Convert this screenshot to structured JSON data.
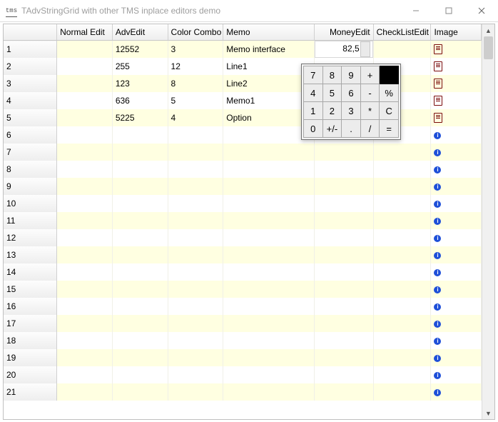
{
  "window": {
    "app_icon_text": "tms",
    "title": "TAdvStringGrid with other TMS inplace editors demo"
  },
  "columns": {
    "c0": "",
    "c1": "Normal Edit",
    "c2": "AdvEdit",
    "c3": "Color Combo",
    "c4": "Memo",
    "c5": "MoneyEdit",
    "c6": "CheckListEdit",
    "c7": "Image"
  },
  "money_editing_value": "82,5",
  "rows": [
    {
      "n": "1",
      "adv": "12552",
      "cc": "3",
      "memo": "Memo interface",
      "money": "82,5",
      "icon": "doc",
      "money_edit": true
    },
    {
      "n": "2",
      "adv": "255",
      "cc": "12",
      "memo": "Line1",
      "money": "",
      "icon": "doc"
    },
    {
      "n": "3",
      "adv": "123",
      "cc": "8",
      "memo": "Line2",
      "money": "",
      "icon": "doc"
    },
    {
      "n": "4",
      "adv": "636",
      "cc": "5",
      "memo": "Memo1",
      "money": "",
      "icon": "doc"
    },
    {
      "n": "5",
      "adv": "5225",
      "cc": "4",
      "memo": "Option",
      "money": "",
      "icon": "doc"
    },
    {
      "n": "6",
      "adv": "",
      "cc": "",
      "memo": "",
      "money": "",
      "icon": "info"
    },
    {
      "n": "7",
      "adv": "",
      "cc": "",
      "memo": "",
      "money": "",
      "icon": "info"
    },
    {
      "n": "8",
      "adv": "",
      "cc": "",
      "memo": "",
      "money": "",
      "icon": "info"
    },
    {
      "n": "9",
      "adv": "",
      "cc": "",
      "memo": "",
      "money": "",
      "icon": "info"
    },
    {
      "n": "10",
      "adv": "",
      "cc": "",
      "memo": "",
      "money": "",
      "icon": "info"
    },
    {
      "n": "11",
      "adv": "",
      "cc": "",
      "memo": "",
      "money": "",
      "icon": "info"
    },
    {
      "n": "12",
      "adv": "",
      "cc": "",
      "memo": "",
      "money": "",
      "icon": "info"
    },
    {
      "n": "13",
      "adv": "",
      "cc": "",
      "memo": "",
      "money": "",
      "icon": "info"
    },
    {
      "n": "14",
      "adv": "",
      "cc": "",
      "memo": "",
      "money": "",
      "icon": "info"
    },
    {
      "n": "15",
      "adv": "",
      "cc": "",
      "memo": "",
      "money": "",
      "icon": "info"
    },
    {
      "n": "16",
      "adv": "",
      "cc": "",
      "memo": "",
      "money": "",
      "icon": "info"
    },
    {
      "n": "17",
      "adv": "",
      "cc": "",
      "memo": "",
      "money": "",
      "icon": "info"
    },
    {
      "n": "18",
      "adv": "",
      "cc": "",
      "memo": "",
      "money": "",
      "icon": "info"
    },
    {
      "n": "19",
      "adv": "",
      "cc": "",
      "memo": "",
      "money": "",
      "icon": "info"
    },
    {
      "n": "20",
      "adv": "",
      "cc": "",
      "memo": "",
      "money": "",
      "icon": "info"
    },
    {
      "n": "21",
      "adv": "",
      "cc": "",
      "memo": "",
      "money": "",
      "icon": "info"
    }
  ],
  "calc": {
    "rows": [
      [
        "7",
        "8",
        "9",
        "+",
        ""
      ],
      [
        "4",
        "5",
        "6",
        "-",
        "%"
      ],
      [
        "1",
        "2",
        "3",
        "*",
        "C"
      ],
      [
        "0",
        "+/-",
        ".",
        "/",
        "="
      ]
    ]
  }
}
